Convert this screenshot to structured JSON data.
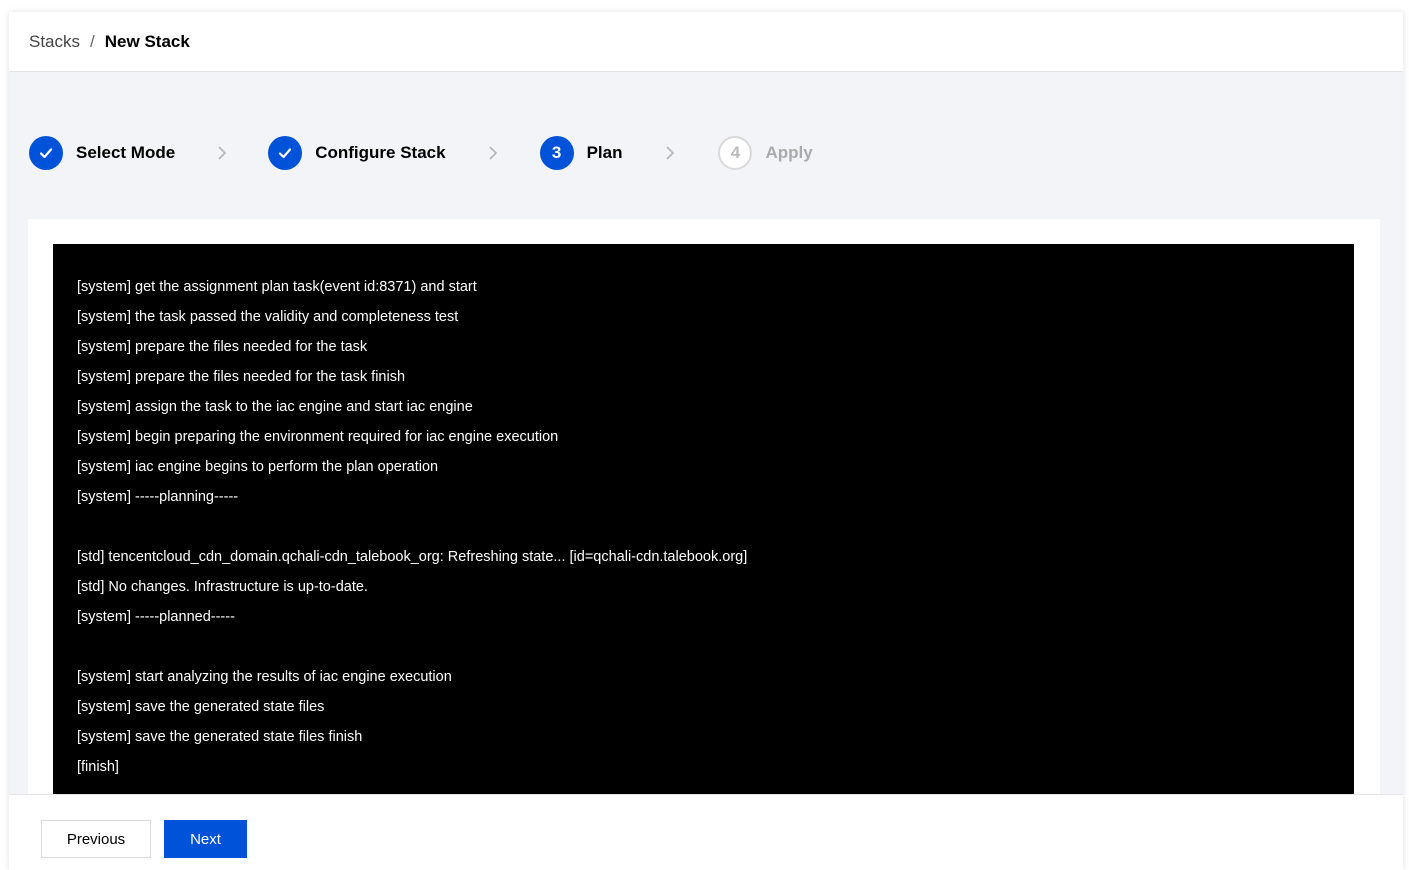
{
  "breadcrumb": {
    "parent": "Stacks",
    "separator": "/",
    "current": "New Stack"
  },
  "steps": [
    {
      "label": "Select Mode",
      "status": "done",
      "icon": "check-icon"
    },
    {
      "label": "Configure Stack",
      "status": "done",
      "icon": "check-icon"
    },
    {
      "number": "3",
      "label": "Plan",
      "status": "active"
    },
    {
      "number": "4",
      "label": "Apply",
      "status": "pending"
    }
  ],
  "console": {
    "lines": [
      "[system] get the assignment plan task(event id:8371) and start",
      "[system] the task passed the validity and completeness test",
      "[system] prepare the files needed for the task",
      "[system] prepare the files needed for the task finish",
      "[system] assign the task to the iac engine and start iac engine",
      "[system] begin preparing the environment required for iac engine execution",
      "[system] iac engine begins to perform the plan operation",
      "[system] -----planning-----",
      "",
      "[std] tencentcloud_cdn_domain.qchali-cdn_talebook_org: Refreshing state... [id=qchali-cdn.talebook.org]",
      "[std] No changes. Infrastructure is up-to-date.",
      "[system] -----planned-----",
      "",
      "[system] start analyzing the results of iac engine execution",
      "[system] save the generated state files",
      "[system] save the generated state files finish",
      "[finish]"
    ]
  },
  "footer": {
    "previous_label": "Previous",
    "next_label": "Next"
  },
  "colors": {
    "primary": "#0052d9",
    "console_bg": "#000000",
    "page_bg": "#f3f4f7"
  }
}
